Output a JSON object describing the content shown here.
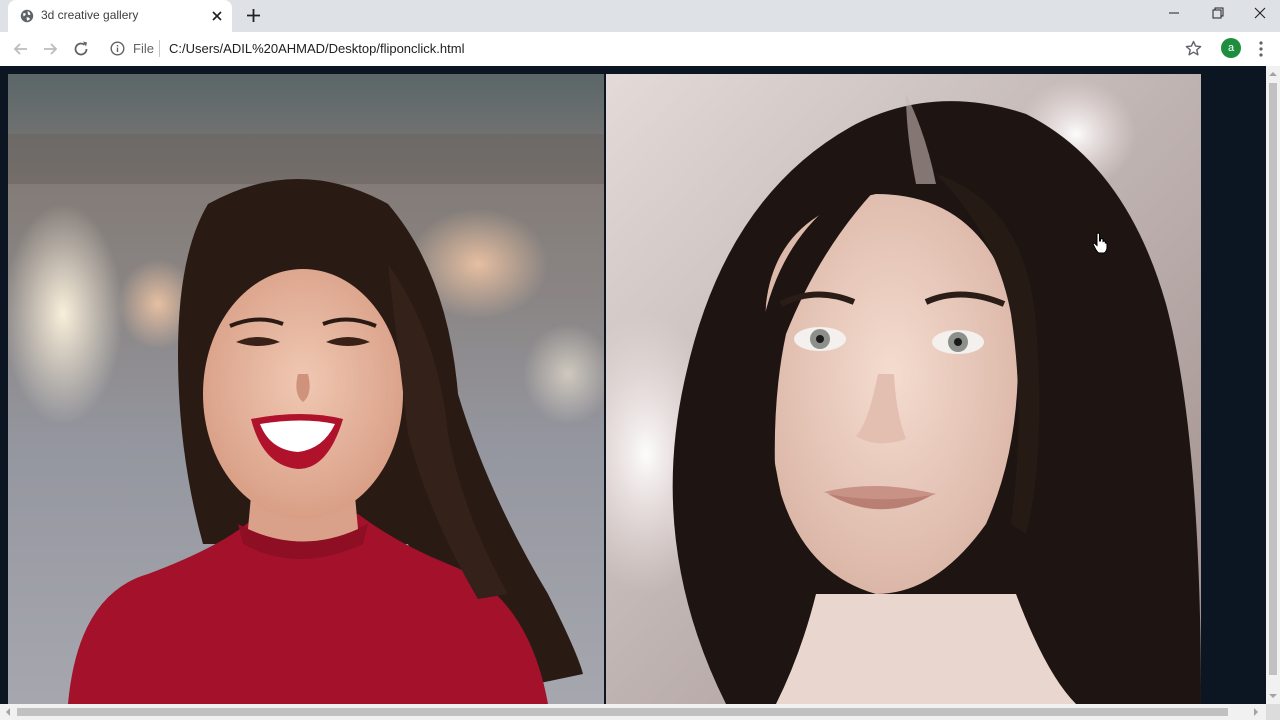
{
  "tab": {
    "title": "3d creative gallery"
  },
  "toolbar": {
    "scheme": "File",
    "url": "C:/Users/ADIL%20AHMAD/Desktop/fliponclick.html",
    "profile_initial": "a"
  },
  "gallery": {
    "cards": [
      {
        "name": "smiling woman in red top",
        "hair": "#2a1a14",
        "top_color": "#a3112b"
      },
      {
        "name": "woman with dark hair and grey eyes",
        "hair": "#1e1512",
        "top_color": "#e9d6cf"
      }
    ]
  },
  "colors": {
    "page_background": "#0b1622",
    "tabstrip": "#dee1e6",
    "profile_avatar": "#1e8e3e"
  },
  "icons": {
    "favicon": "globe-icon",
    "tab_close": "close-icon",
    "new_tab": "plus-icon",
    "back": "arrow-left-icon",
    "forward": "arrow-right-icon",
    "reload": "reload-icon",
    "site_info": "info-icon",
    "bookmark": "star-icon",
    "menu": "kebab-menu-icon"
  }
}
